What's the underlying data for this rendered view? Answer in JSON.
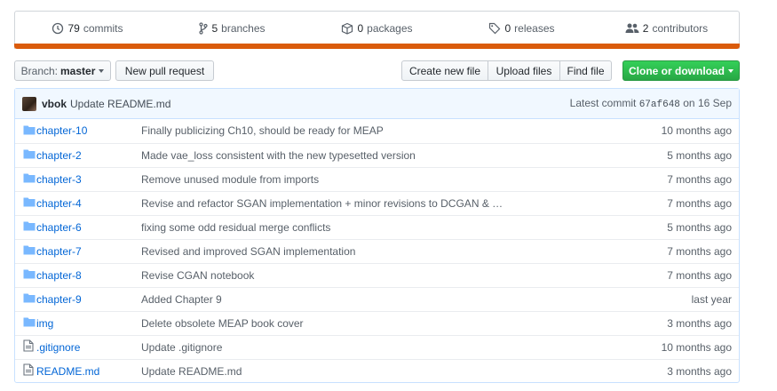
{
  "summary": {
    "commits": {
      "num": "79",
      "label": "commits",
      "icon": "history-icon"
    },
    "branches": {
      "num": "5",
      "label": "branches",
      "icon": "git-branch-icon"
    },
    "packages": {
      "num": "0",
      "label": "packages",
      "icon": "package-icon"
    },
    "releases": {
      "num": "0",
      "label": "releases",
      "icon": "tag-icon"
    },
    "contributors": {
      "num": "2",
      "label": "contributors",
      "icon": "people-icon"
    },
    "language_bar_color": "#da5b0b"
  },
  "toolbar": {
    "branch_prefix": "Branch:",
    "branch_name": "master",
    "new_pull_request": "New pull request",
    "create_new_file": "Create new file",
    "upload_files": "Upload files",
    "find_file": "Find file",
    "clone_or_download": "Clone or download",
    "clone_color": "#28a745"
  },
  "latest_commit": {
    "author": "vbok",
    "message": "Update README.md",
    "label": "Latest commit",
    "sha": "67af648",
    "on": "on",
    "date": "16 Sep"
  },
  "files": [
    {
      "type": "dir",
      "name": "chapter-10",
      "message": "Finally publicizing Ch10, should be ready for MEAP",
      "age": "10 months ago"
    },
    {
      "type": "dir",
      "name": "chapter-2",
      "message": "Made vae_loss consistent with the new typesetted version",
      "age": "5 months ago"
    },
    {
      "type": "dir",
      "name": "chapter-3",
      "message": "Remove unused module from imports",
      "age": "7 months ago"
    },
    {
      "type": "dir",
      "name": "chapter-4",
      "message": "Revise and refactor SGAN implementation + minor revisions to DCGAN & …",
      "age": "7 months ago"
    },
    {
      "type": "dir",
      "name": "chapter-6",
      "message": "fixing some odd residual merge conflicts",
      "age": "5 months ago"
    },
    {
      "type": "dir",
      "name": "chapter-7",
      "message": "Revised and improved SGAN implementation",
      "age": "7 months ago"
    },
    {
      "type": "dir",
      "name": "chapter-8",
      "message": "Revise CGAN notebook",
      "age": "7 months ago"
    },
    {
      "type": "dir",
      "name": "chapter-9",
      "message": "Added Chapter 9",
      "age": "last year"
    },
    {
      "type": "dir",
      "name": "img",
      "message": "Delete obsolete MEAP book cover",
      "age": "3 months ago"
    },
    {
      "type": "file",
      "name": ".gitignore",
      "message": "Update .gitignore",
      "age": "10 months ago"
    },
    {
      "type": "file",
      "name": "README.md",
      "message": "Update README.md",
      "age": "3 months ago"
    }
  ],
  "colors": {
    "link": "#0366d6",
    "folder_icon": "#79b8ff",
    "file_icon": "#6a737d",
    "commit_bg": "#f1f8ff"
  }
}
